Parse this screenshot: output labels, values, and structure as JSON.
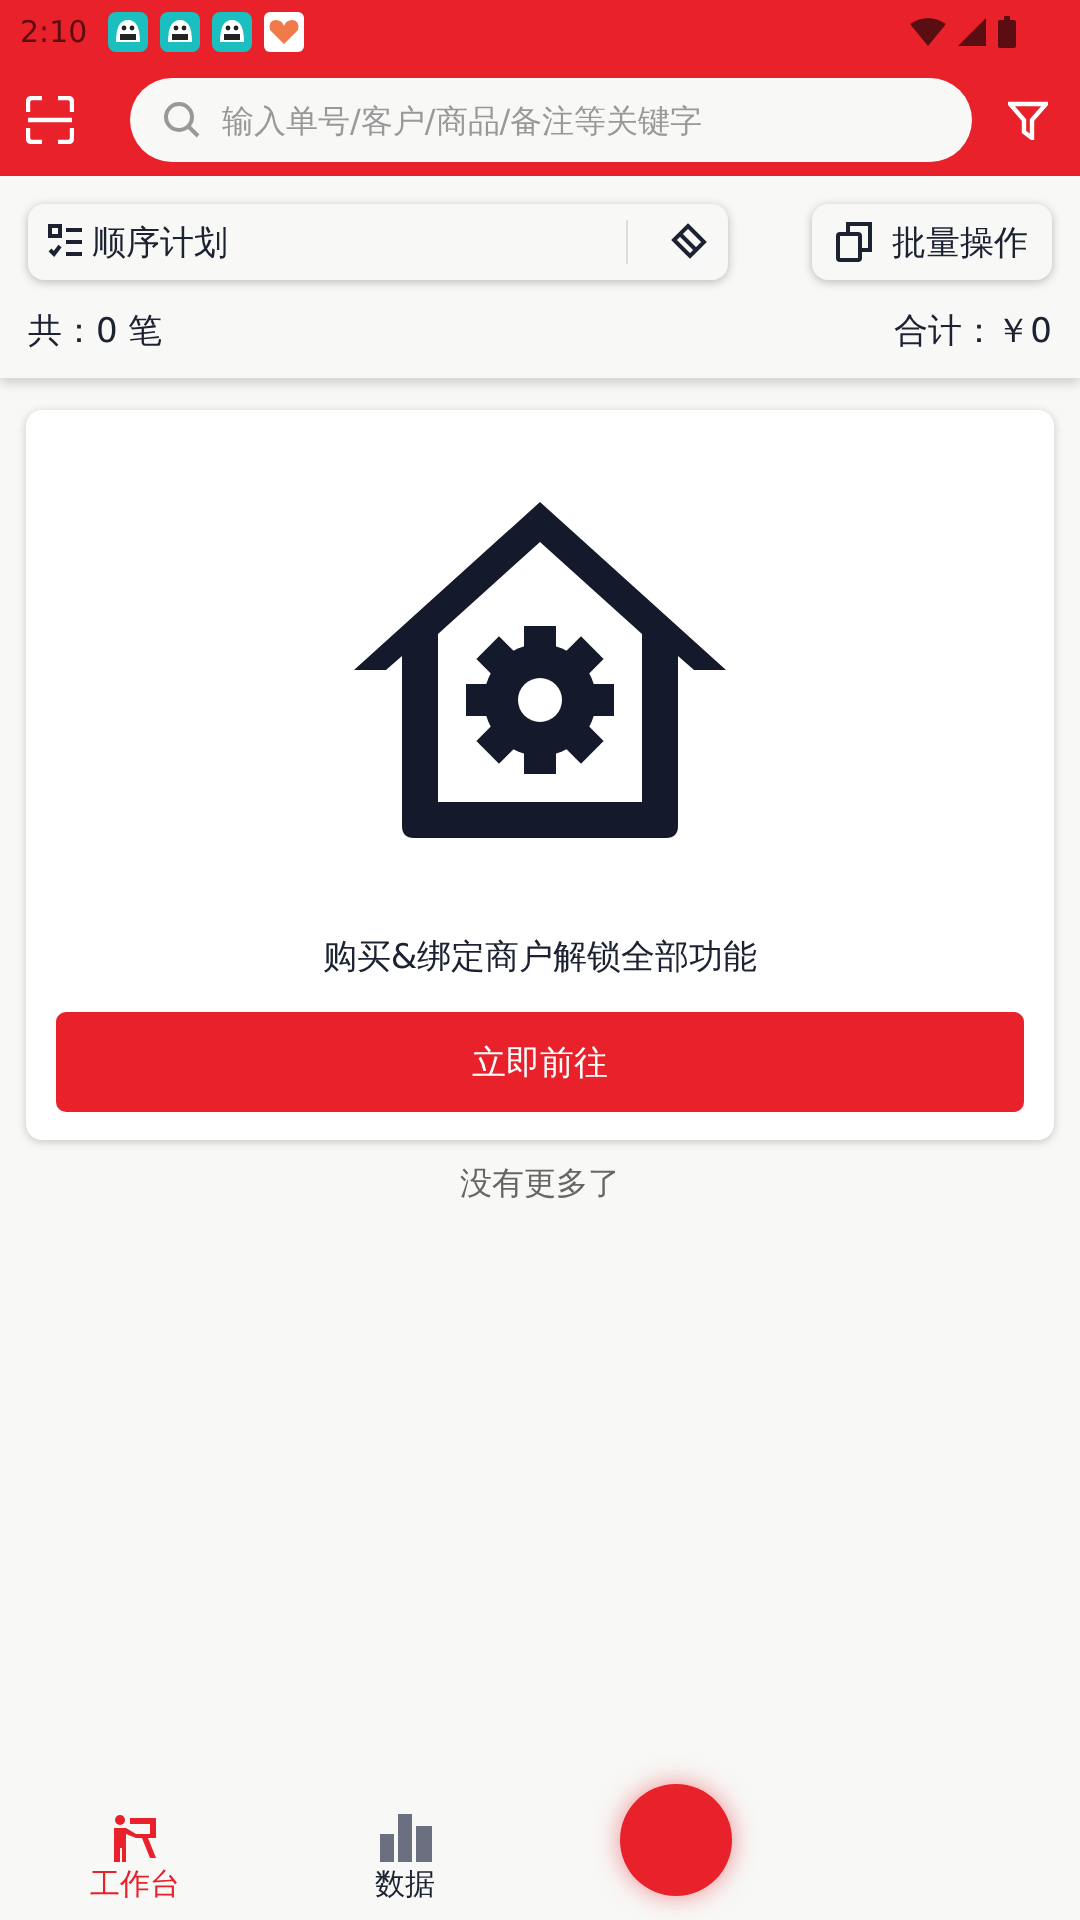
{
  "status_bar": {
    "time": "2:10"
  },
  "search": {
    "placeholder": "输入单号/客户/商品/备注等关键字"
  },
  "toolbar": {
    "plan_label": "顺序计划",
    "batch_label": "批量操作"
  },
  "summary": {
    "count": "共：0 笔",
    "total": "合计：￥0"
  },
  "promo": {
    "message": "购买&绑定商户解锁全部功能",
    "button": "立即前往"
  },
  "end_note": "没有更多了",
  "bottom_nav": [
    {
      "label": "工作台",
      "kind": "workbench",
      "selected": true
    },
    {
      "label": "数据",
      "kind": "data",
      "selected": false
    }
  ]
}
